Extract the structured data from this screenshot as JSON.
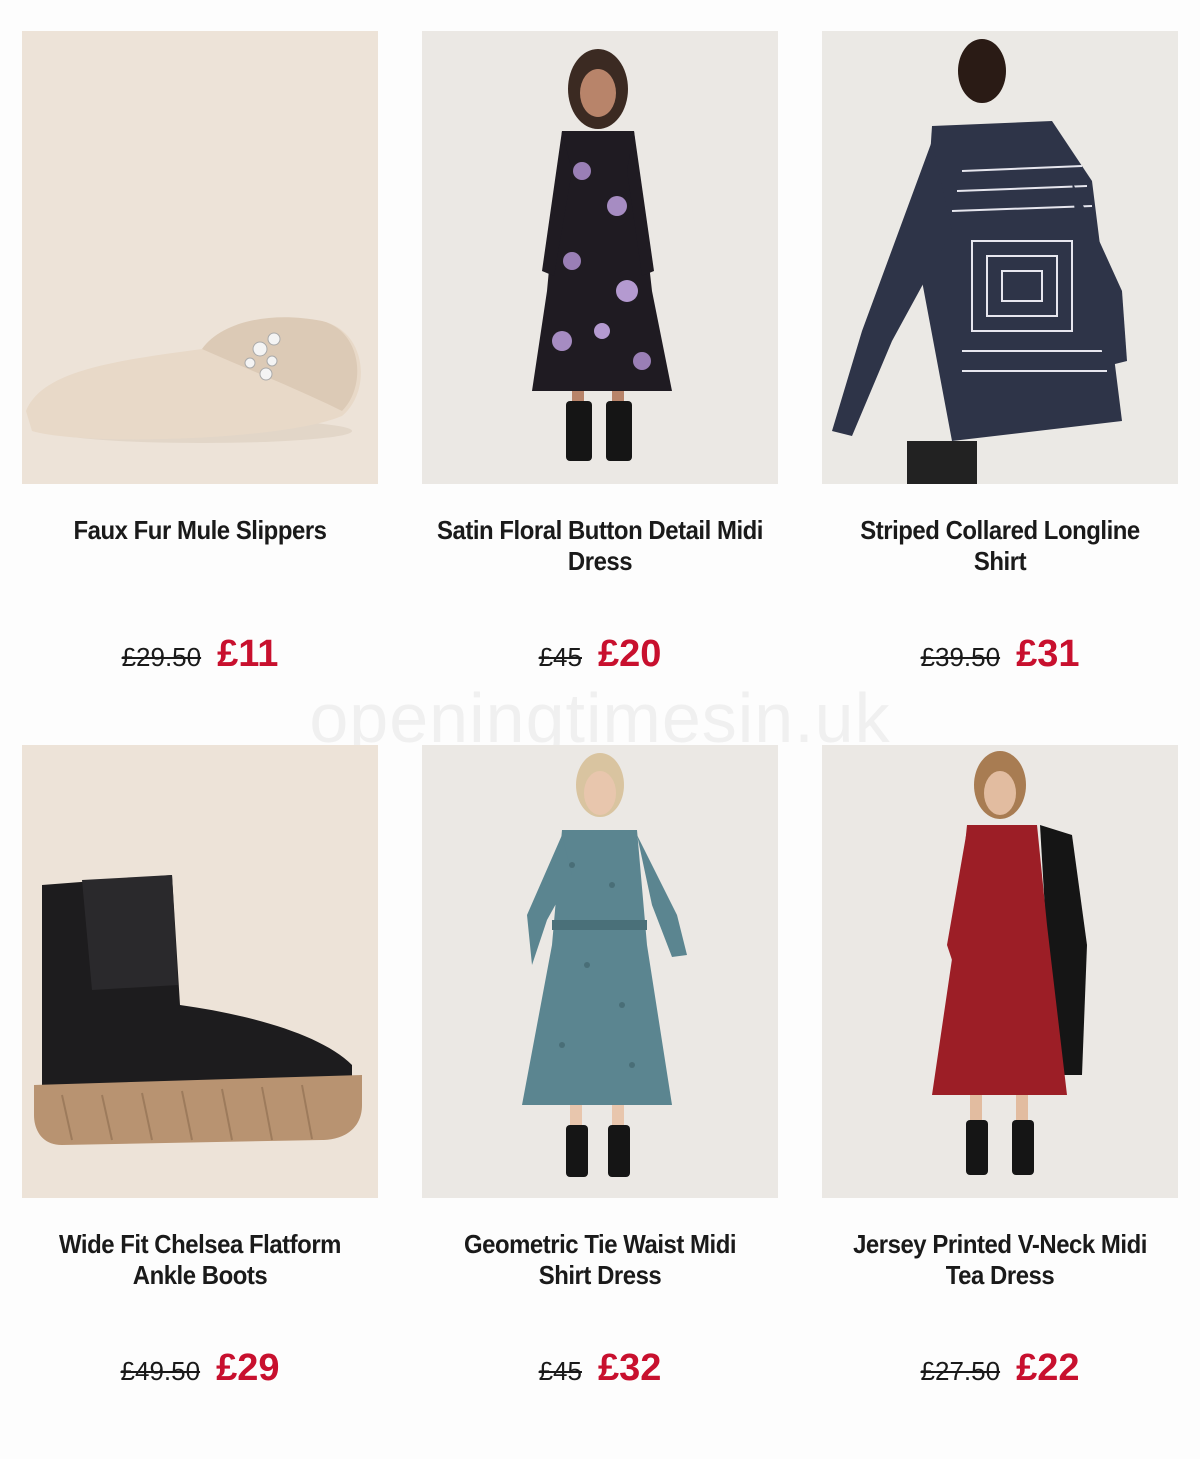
{
  "watermark": "openingtimesin.uk",
  "colors": {
    "sale": "#c8102e",
    "text": "#1a1a1a"
  },
  "products": [
    {
      "name": "Faux Fur Mule Slippers",
      "old_price": "£29.50",
      "price": "£11",
      "image": "slipper"
    },
    {
      "name": "Satin Floral Button Detail Midi Dress",
      "old_price": "£45",
      "price": "£20",
      "image": "floral-dress"
    },
    {
      "name": "Striped Collared Longline Shirt",
      "old_price": "£39.50",
      "price": "£31",
      "image": "striped-shirt"
    },
    {
      "name": "Wide Fit Chelsea Flatform Ankle Boots",
      "old_price": "£49.50",
      "price": "£29",
      "image": "chelsea-boot"
    },
    {
      "name": "Geometric Tie Waist Midi Shirt Dress",
      "old_price": "£45",
      "price": "£32",
      "image": "shirt-dress"
    },
    {
      "name": "Jersey Printed V-Neck Midi Tea Dress",
      "old_price": "£27.50",
      "price": "£22",
      "image": "tea-dress"
    }
  ]
}
